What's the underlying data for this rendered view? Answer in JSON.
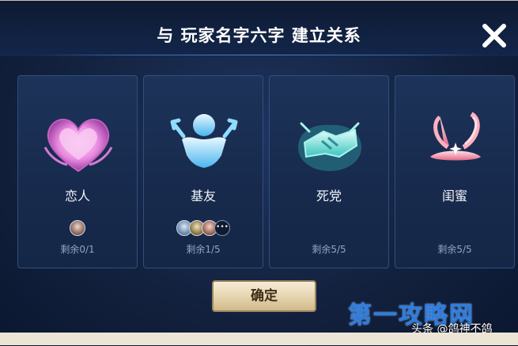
{
  "dialog": {
    "title": "与 玩家名字六字 建立关系",
    "confirm_label": "确定"
  },
  "relationships": [
    {
      "name": "恋人",
      "remaining": "剩余0/1",
      "icon": "heart-icon",
      "color": "#f2a2e6"
    },
    {
      "name": "基友",
      "remaining": "剩余1/5",
      "icon": "buddy-icon",
      "color": "#8fd8ff"
    },
    {
      "name": "死党",
      "remaining": "剩余5/5",
      "icon": "handshake-icon",
      "color": "#7fe6e0"
    },
    {
      "name": "闺蜜",
      "remaining": "剩余5/5",
      "icon": "bunny-ears-icon",
      "color": "#ffb0bf"
    }
  ],
  "watermark": {
    "text": "第一攻略网",
    "credit": "头条 @鸽神不鸽"
  },
  "colors": {
    "accent": "#d6c194",
    "panel": "#1d3359",
    "title_text": "#ffffff"
  }
}
